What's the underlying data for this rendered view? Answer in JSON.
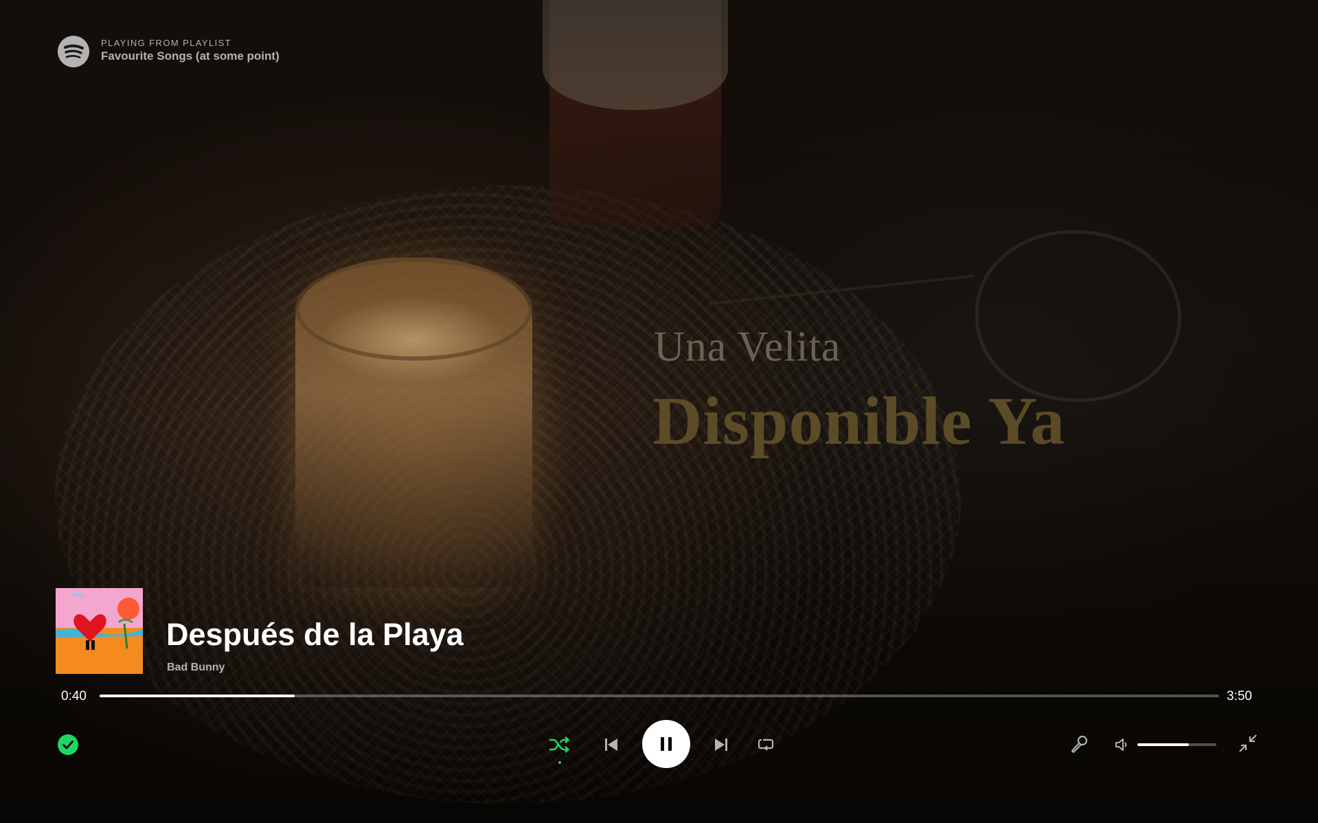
{
  "header": {
    "context_label": "PLAYING FROM PLAYLIST",
    "playlist_name": "Favourite Songs (at some point)"
  },
  "background_promo": {
    "line1": "Una Velita",
    "line2": "Disponible Ya"
  },
  "track": {
    "title": "Después de la Playa",
    "artist": "Bad Bunny",
    "liked": true
  },
  "playback": {
    "elapsed": "0:40",
    "duration": "3:50",
    "progress_fraction": 0.174,
    "shuffle_on": true,
    "is_playing": true,
    "volume_fraction": 0.65
  },
  "icons": {
    "logo": "spotify-logo-icon",
    "liked": "check-circle-icon",
    "shuffle": "shuffle-icon",
    "previous": "skip-back-icon",
    "pause": "pause-icon",
    "next": "skip-forward-icon",
    "repeat": "repeat-icon",
    "lyrics": "microphone-icon",
    "volume": "volume-icon",
    "exit_fullscreen": "minimize-icon"
  },
  "colors": {
    "accent_green": "#1ed760",
    "text_primary": "#ffffff",
    "text_secondary": "#b3b3b3"
  }
}
